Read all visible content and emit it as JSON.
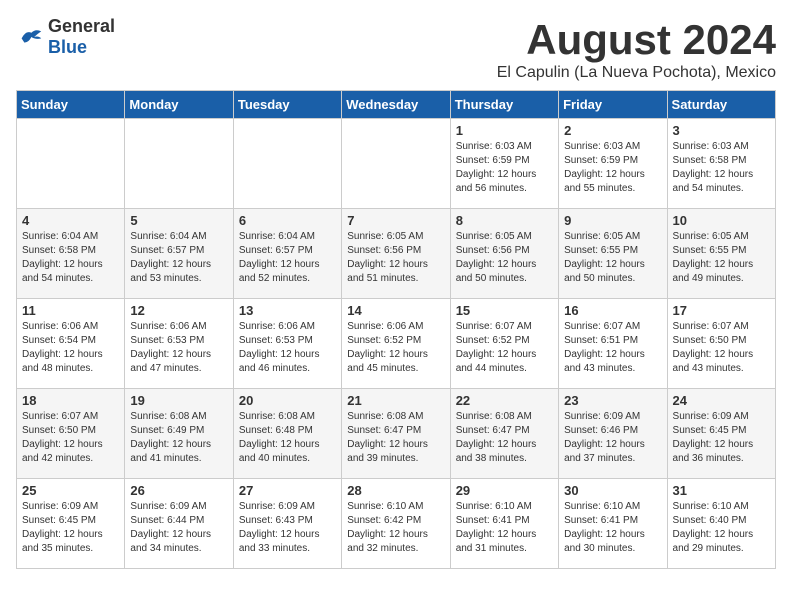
{
  "header": {
    "logo_general": "General",
    "logo_blue": "Blue",
    "main_title": "August 2024",
    "subtitle": "El Capulin (La Nueva Pochota), Mexico"
  },
  "calendar": {
    "days_of_week": [
      "Sunday",
      "Monday",
      "Tuesday",
      "Wednesday",
      "Thursday",
      "Friday",
      "Saturday"
    ],
    "weeks": [
      [
        {
          "day": "",
          "info": ""
        },
        {
          "day": "",
          "info": ""
        },
        {
          "day": "",
          "info": ""
        },
        {
          "day": "",
          "info": ""
        },
        {
          "day": "1",
          "info": "Sunrise: 6:03 AM\nSunset: 6:59 PM\nDaylight: 12 hours\nand 56 minutes."
        },
        {
          "day": "2",
          "info": "Sunrise: 6:03 AM\nSunset: 6:59 PM\nDaylight: 12 hours\nand 55 minutes."
        },
        {
          "day": "3",
          "info": "Sunrise: 6:03 AM\nSunset: 6:58 PM\nDaylight: 12 hours\nand 54 minutes."
        }
      ],
      [
        {
          "day": "4",
          "info": "Sunrise: 6:04 AM\nSunset: 6:58 PM\nDaylight: 12 hours\nand 54 minutes."
        },
        {
          "day": "5",
          "info": "Sunrise: 6:04 AM\nSunset: 6:57 PM\nDaylight: 12 hours\nand 53 minutes."
        },
        {
          "day": "6",
          "info": "Sunrise: 6:04 AM\nSunset: 6:57 PM\nDaylight: 12 hours\nand 52 minutes."
        },
        {
          "day": "7",
          "info": "Sunrise: 6:05 AM\nSunset: 6:56 PM\nDaylight: 12 hours\nand 51 minutes."
        },
        {
          "day": "8",
          "info": "Sunrise: 6:05 AM\nSunset: 6:56 PM\nDaylight: 12 hours\nand 50 minutes."
        },
        {
          "day": "9",
          "info": "Sunrise: 6:05 AM\nSunset: 6:55 PM\nDaylight: 12 hours\nand 50 minutes."
        },
        {
          "day": "10",
          "info": "Sunrise: 6:05 AM\nSunset: 6:55 PM\nDaylight: 12 hours\nand 49 minutes."
        }
      ],
      [
        {
          "day": "11",
          "info": "Sunrise: 6:06 AM\nSunset: 6:54 PM\nDaylight: 12 hours\nand 48 minutes."
        },
        {
          "day": "12",
          "info": "Sunrise: 6:06 AM\nSunset: 6:53 PM\nDaylight: 12 hours\nand 47 minutes."
        },
        {
          "day": "13",
          "info": "Sunrise: 6:06 AM\nSunset: 6:53 PM\nDaylight: 12 hours\nand 46 minutes."
        },
        {
          "day": "14",
          "info": "Sunrise: 6:06 AM\nSunset: 6:52 PM\nDaylight: 12 hours\nand 45 minutes."
        },
        {
          "day": "15",
          "info": "Sunrise: 6:07 AM\nSunset: 6:52 PM\nDaylight: 12 hours\nand 44 minutes."
        },
        {
          "day": "16",
          "info": "Sunrise: 6:07 AM\nSunset: 6:51 PM\nDaylight: 12 hours\nand 43 minutes."
        },
        {
          "day": "17",
          "info": "Sunrise: 6:07 AM\nSunset: 6:50 PM\nDaylight: 12 hours\nand 43 minutes."
        }
      ],
      [
        {
          "day": "18",
          "info": "Sunrise: 6:07 AM\nSunset: 6:50 PM\nDaylight: 12 hours\nand 42 minutes."
        },
        {
          "day": "19",
          "info": "Sunrise: 6:08 AM\nSunset: 6:49 PM\nDaylight: 12 hours\nand 41 minutes."
        },
        {
          "day": "20",
          "info": "Sunrise: 6:08 AM\nSunset: 6:48 PM\nDaylight: 12 hours\nand 40 minutes."
        },
        {
          "day": "21",
          "info": "Sunrise: 6:08 AM\nSunset: 6:47 PM\nDaylight: 12 hours\nand 39 minutes."
        },
        {
          "day": "22",
          "info": "Sunrise: 6:08 AM\nSunset: 6:47 PM\nDaylight: 12 hours\nand 38 minutes."
        },
        {
          "day": "23",
          "info": "Sunrise: 6:09 AM\nSunset: 6:46 PM\nDaylight: 12 hours\nand 37 minutes."
        },
        {
          "day": "24",
          "info": "Sunrise: 6:09 AM\nSunset: 6:45 PM\nDaylight: 12 hours\nand 36 minutes."
        }
      ],
      [
        {
          "day": "25",
          "info": "Sunrise: 6:09 AM\nSunset: 6:45 PM\nDaylight: 12 hours\nand 35 minutes."
        },
        {
          "day": "26",
          "info": "Sunrise: 6:09 AM\nSunset: 6:44 PM\nDaylight: 12 hours\nand 34 minutes."
        },
        {
          "day": "27",
          "info": "Sunrise: 6:09 AM\nSunset: 6:43 PM\nDaylight: 12 hours\nand 33 minutes."
        },
        {
          "day": "28",
          "info": "Sunrise: 6:10 AM\nSunset: 6:42 PM\nDaylight: 12 hours\nand 32 minutes."
        },
        {
          "day": "29",
          "info": "Sunrise: 6:10 AM\nSunset: 6:41 PM\nDaylight: 12 hours\nand 31 minutes."
        },
        {
          "day": "30",
          "info": "Sunrise: 6:10 AM\nSunset: 6:41 PM\nDaylight: 12 hours\nand 30 minutes."
        },
        {
          "day": "31",
          "info": "Sunrise: 6:10 AM\nSunset: 6:40 PM\nDaylight: 12 hours\nand 29 minutes."
        }
      ]
    ]
  }
}
